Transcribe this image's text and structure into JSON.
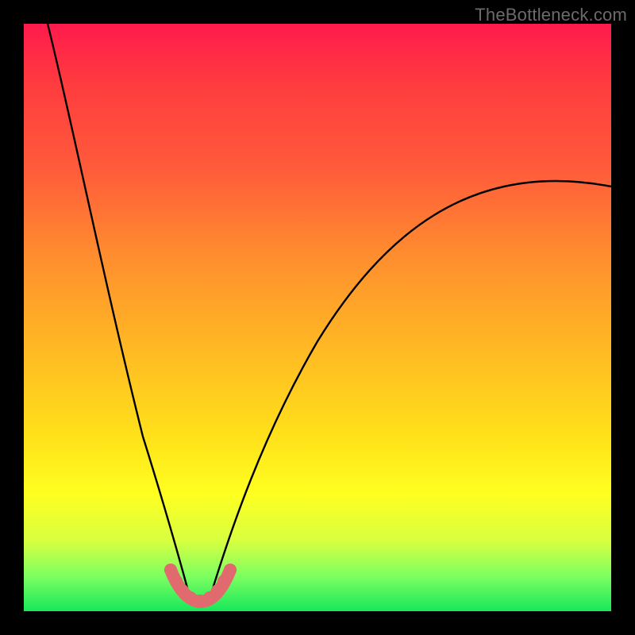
{
  "attribution": "TheBottleneck.com",
  "chart_data": {
    "type": "line",
    "title": "",
    "xlabel": "",
    "ylabel": "",
    "xlim": [
      0,
      100
    ],
    "ylim": [
      0,
      100
    ],
    "grid": false,
    "legend": false,
    "background_gradient": {
      "direction": "vertical",
      "stops": [
        {
          "pos": 0.0,
          "color": "#ff1a4d"
        },
        {
          "pos": 0.55,
          "color": "#ffb824"
        },
        {
          "pos": 0.8,
          "color": "#ffff20"
        },
        {
          "pos": 1.0,
          "color": "#18e85b"
        }
      ]
    },
    "series": [
      {
        "name": "left-branch",
        "stroke": "#000000",
        "x": [
          4,
          6,
          8,
          10,
          12,
          14,
          16,
          18,
          20,
          22,
          24,
          25,
          26,
          27,
          28
        ],
        "y": [
          100,
          84,
          70,
          58,
          48,
          39,
          31,
          24,
          18,
          12,
          7,
          5,
          3.5,
          2.5,
          2
        ]
      },
      {
        "name": "right-branch",
        "stroke": "#000000",
        "x": [
          32,
          33,
          34,
          36,
          38,
          42,
          46,
          52,
          58,
          66,
          74,
          82,
          90,
          98,
          100
        ],
        "y": [
          2,
          2.5,
          3.5,
          6,
          9,
          15,
          21,
          29,
          36,
          44,
          52,
          59,
          65,
          71,
          72
        ]
      },
      {
        "name": "valley-marker",
        "stroke": "#e26a6e",
        "stroke_width": 14,
        "x": [
          25,
          26,
          27,
          28,
          29,
          30,
          31,
          32,
          33,
          34,
          35
        ],
        "y": [
          5,
          3.5,
          2.5,
          2,
          1.8,
          1.8,
          1.8,
          2,
          2.5,
          3.5,
          5
        ]
      }
    ],
    "notes": "Y values are estimated from pixel heights relative to the plot area; chart has no axis ticks or labels."
  }
}
